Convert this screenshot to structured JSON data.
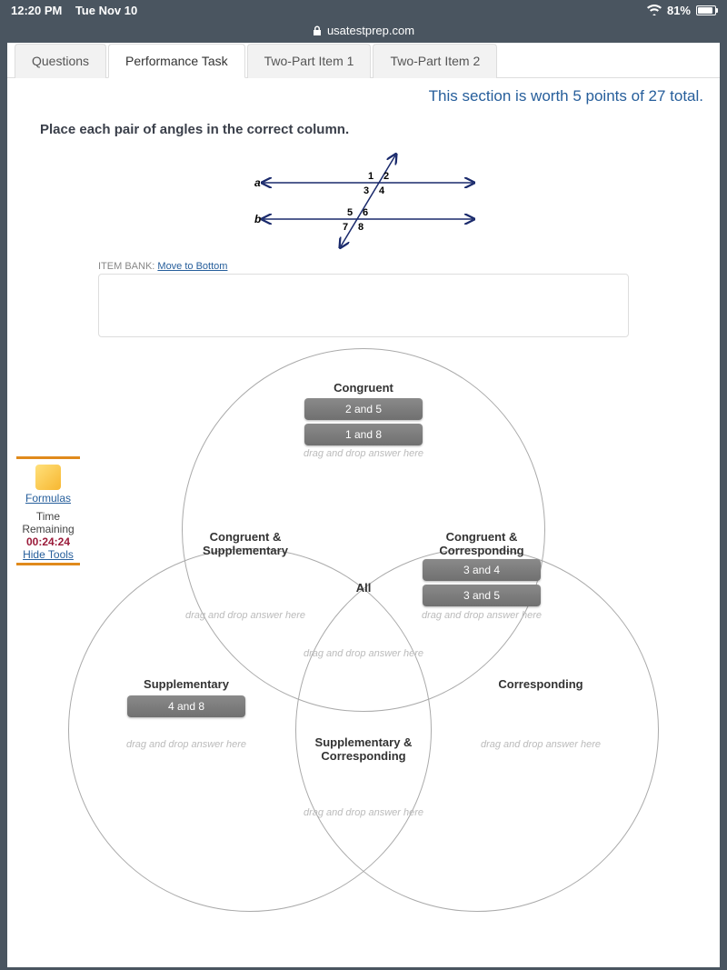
{
  "status": {
    "time": "12:20 PM",
    "date": "Tue Nov 10",
    "battery": "81%",
    "url": "usatestprep.com"
  },
  "tabs": [
    {
      "label": "Questions",
      "active": false
    },
    {
      "label": "Performance Task",
      "active": true
    },
    {
      "label": "Two-Part Item 1",
      "active": false
    },
    {
      "label": "Two-Part Item 2",
      "active": false
    }
  ],
  "points_line": "This section is worth 5 points of 27 total.",
  "prompt": "Place each pair of angles in the correct column.",
  "figure": {
    "line_a_label": "a",
    "line_b_label": "b",
    "angles": [
      "1",
      "2",
      "3",
      "4",
      "5",
      "6",
      "7",
      "8"
    ]
  },
  "item_bank": {
    "label": "ITEM BANK:",
    "link": "Move to Bottom"
  },
  "tools": {
    "formulas": "Formulas",
    "time_label": "Time Remaining",
    "time_value": "00:24:24",
    "hide": "Hide Tools"
  },
  "venn": {
    "regions": {
      "congruent": "Congruent",
      "cong_supp": "Congruent & Supplementary",
      "cong_corr": "Congruent & Corresponding",
      "all": "All",
      "supplementary": "Supplementary",
      "supp_corr": "Supplementary & Corresponding",
      "corresponding": "Corresponding"
    },
    "drop_hint": "drag and drop answer here",
    "chips": {
      "c1": "2 and 5",
      "c2": "1 and 8",
      "c3": "3 and 4",
      "c4": "3 and 5",
      "c5": "4 and 8"
    }
  }
}
